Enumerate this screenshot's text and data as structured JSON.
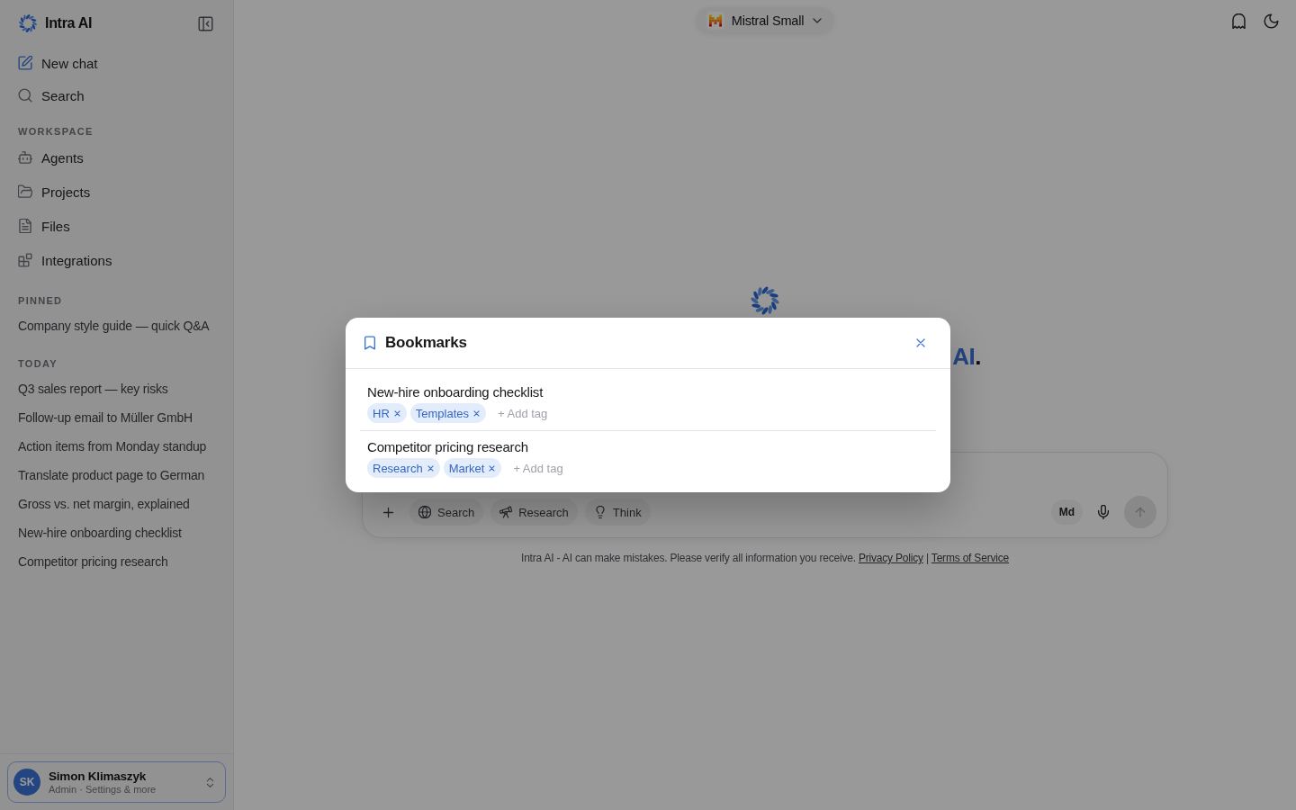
{
  "sidebar": {
    "brand": "Intra AI",
    "nav": [
      {
        "label": "New chat"
      },
      {
        "label": "Search"
      }
    ],
    "sections": [
      {
        "title": "WORKSPACE",
        "kind": "links",
        "items": [
          {
            "label": "Agents"
          },
          {
            "label": "Projects"
          },
          {
            "label": "Files"
          },
          {
            "label": "Integrations"
          }
        ]
      },
      {
        "title": "PINNED",
        "kind": "chats",
        "items": [
          {
            "label": "Company style guide — quick Q&A"
          }
        ]
      },
      {
        "title": "TODAY",
        "kind": "chats",
        "items": [
          {
            "label": "Q3 sales report — key risks"
          },
          {
            "label": "Follow-up email to Müller GmbH"
          },
          {
            "label": "Action items from Monday standup"
          },
          {
            "label": "Translate product page to German"
          },
          {
            "label": "Gross vs. net margin, explained"
          },
          {
            "label": "New-hire onboarding checklist"
          },
          {
            "label": "Competitor pricing research"
          }
        ]
      }
    ],
    "user": {
      "initials": "SK",
      "name": "Simon Klimaszyk",
      "subtitle": "Admin · Settings & more"
    }
  },
  "top_bar": {
    "model_selector": {
      "label": "Mistral Small"
    }
  },
  "welcome": {
    "heading": {
      "accent": "AI",
      "rest": "."
    }
  },
  "composer": {
    "tools": [
      {
        "label": "Search",
        "selected": false
      },
      {
        "label": "Research",
        "selected": false
      },
      {
        "label": "Think",
        "selected": false
      }
    ],
    "format_button": "Md",
    "send_button": {
      "disabled": true
    }
  },
  "disclaimer": {
    "text": "Intra AI - AI can make mistakes. Please verify all information you receive.",
    "links": [
      {
        "label": "Privacy Policy"
      },
      {
        "label": "Terms of Service"
      }
    ],
    "separator": "|"
  },
  "bookmarks_dialog": {
    "title": "Bookmarks",
    "items": [
      {
        "title": "New-hire onboarding checklist",
        "tags": [
          {
            "label": "HR"
          },
          {
            "label": "Templates"
          }
        ],
        "add_tag": "+ Add tag"
      },
      {
        "title": "Competitor pricing research",
        "tags": [
          {
            "label": "Research"
          },
          {
            "label": "Market"
          }
        ],
        "add_tag": "+ Add tag"
      }
    ]
  }
}
